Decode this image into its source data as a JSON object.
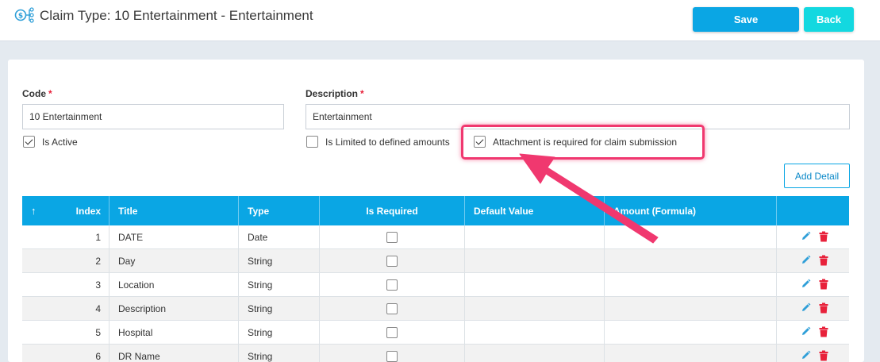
{
  "header": {
    "title": "Claim Type: 10 Entertainment - Entertainment",
    "title_icon": "claim-type-icon",
    "save_label": "Save",
    "back_label": "Back"
  },
  "form": {
    "code_label": "Code",
    "code_value": "10 Entertainment",
    "description_label": "Description",
    "description_value": "Entertainment",
    "required_mark": "*",
    "is_active_label": "Is Active",
    "is_active_checked": true,
    "is_limited_label": "Is Limited to defined amounts",
    "is_limited_checked": false,
    "attachment_label": "Attachment is required for claim submission",
    "attachment_checked": true
  },
  "add_detail_label": "Add Detail",
  "table": {
    "sort_icon": "sort-up-arrow-icon",
    "columns": [
      "Index",
      "Title",
      "Type",
      "Is Required",
      "Default Value",
      "Amount (Formula)"
    ],
    "rows": [
      {
        "index": "1",
        "title": "DATE",
        "type": "Date"
      },
      {
        "index": "2",
        "title": "Day",
        "type": "String"
      },
      {
        "index": "3",
        "title": "Location",
        "type": "String"
      },
      {
        "index": "4",
        "title": "Description",
        "type": "String"
      },
      {
        "index": "5",
        "title": "Hospital",
        "type": "String"
      },
      {
        "index": "6",
        "title": "DR Name",
        "type": "String"
      }
    ]
  },
  "colors": {
    "primary": "#0aa6e4",
    "back": "#13d8e0",
    "highlight": "#f0386f",
    "delete": "#e8223b",
    "edit": "#2f9fd8"
  }
}
